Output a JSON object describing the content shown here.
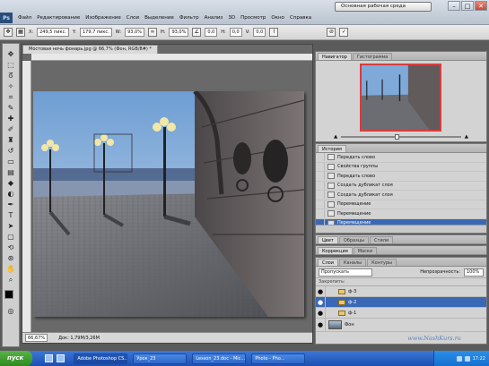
{
  "workspace_label": "Основная рабочая среда",
  "menu": [
    "Файл",
    "Редактирование",
    "Изображение",
    "Слои",
    "Выделение",
    "Фильтр",
    "Анализ",
    "3D",
    "Просмотр",
    "Окно",
    "Справка"
  ],
  "window_buttons": {
    "minimize": "–",
    "maximize": "□",
    "close": "✕"
  },
  "options": {
    "x_value": "249,5 пикс.",
    "y_value": "179,7 пикс.",
    "w_value": "93,0%",
    "h_value": "93,0%",
    "angle_value": "0,0",
    "h_skew_value": "0,0",
    "v_skew_value": "0,0"
  },
  "document": {
    "tab_title": "Мостовая ночь фонарь.jpg @ 66,7% (Фон, RGB/8#) *",
    "zoom": "66,67%",
    "doc_size": "Док: 1,79M/3,26M"
  },
  "navigator": {
    "tabs": [
      "Навигатор",
      "Гистограмма"
    ]
  },
  "history": {
    "tabs": [
      "История"
    ],
    "items": [
      "Передать слово",
      "Свойства группы",
      "Передать слово",
      "Создать дубликат слоя",
      "Создать дубликат слоя",
      "Перемещение",
      "Перемещение",
      "Перемещение"
    ],
    "selected_index": 7
  },
  "color_panel": {
    "tabs": [
      "Цвет",
      "Образцы",
      "Стили"
    ]
  },
  "adjust_panel": {
    "tabs": [
      "Коррекция",
      "Маски"
    ]
  },
  "layers": {
    "tabs": [
      "Слои",
      "Каналы",
      "Контуры"
    ],
    "blend_mode": "Пропускать",
    "opacity_label": "Непрозрачность:",
    "opacity_value": "100%",
    "lock_label": "Закрепить:",
    "rows": [
      {
        "name": "ф-3",
        "type": "group",
        "selected": false
      },
      {
        "name": "ф-2",
        "type": "group",
        "selected": true
      },
      {
        "name": "ф-1",
        "type": "group",
        "selected": false
      },
      {
        "name": "Фон",
        "type": "image",
        "selected": false
      }
    ]
  },
  "watermark": "www.NashKurs.ru",
  "taskbar": {
    "start_label": "пуск",
    "tasks": [
      "Adobe Photoshop CS...",
      "Урок_23",
      "Lesson_23.doc - Mic...",
      "Photo - Pho..."
    ],
    "clock": "17:22"
  }
}
